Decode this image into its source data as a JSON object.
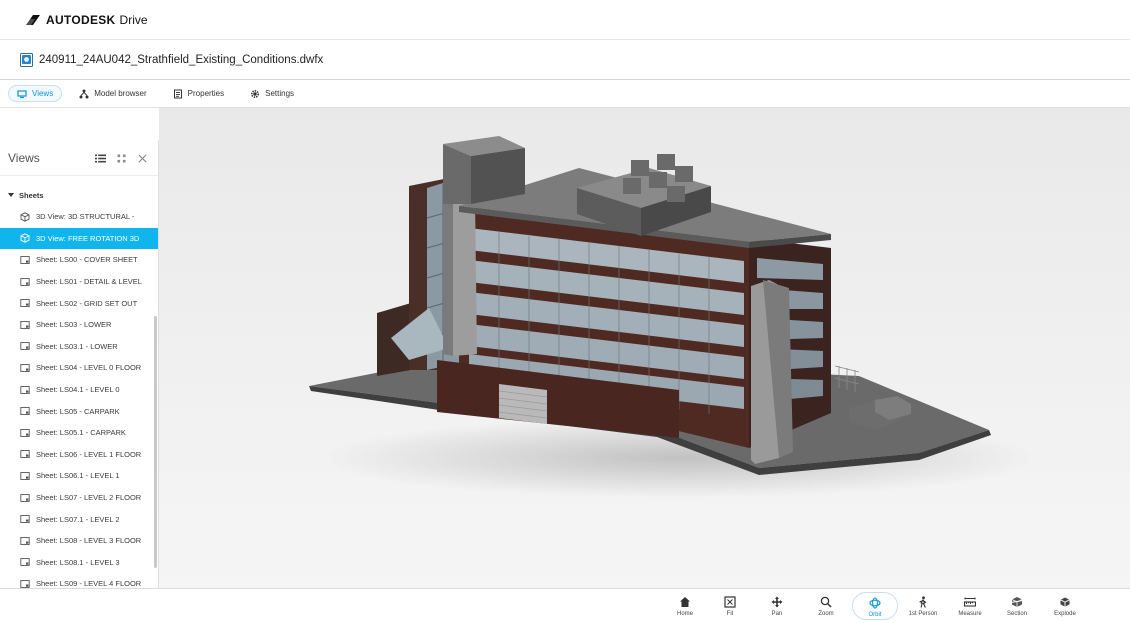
{
  "app": {
    "brand": "AUTODESK",
    "product": "Drive"
  },
  "file": {
    "name": "240911_24AU042_Strathfield_Existing_Conditions.dwfx"
  },
  "tabs": [
    {
      "label": "Views",
      "icon": "views-icon",
      "active": true
    },
    {
      "label": "Model browser",
      "icon": "model-browser-icon",
      "active": false
    },
    {
      "label": "Properties",
      "icon": "properties-icon",
      "active": false
    },
    {
      "label": "Settings",
      "icon": "gear-icon",
      "active": false
    }
  ],
  "panel": {
    "title": "Views",
    "group": "Sheets",
    "items": [
      {
        "label": "3D View: 3D STRUCTURAL -",
        "type": "3d"
      },
      {
        "label": "3D View: FREE ROTATION 3D",
        "type": "3d",
        "selected": true
      },
      {
        "label": "Sheet: LS00 - COVER SHEET",
        "type": "sheet"
      },
      {
        "label": "Sheet: LS01 - DETAIL & LEVEL",
        "type": "sheet"
      },
      {
        "label": "Sheet: LS02 - GRID SET OUT",
        "type": "sheet"
      },
      {
        "label": "Sheet: LS03 - LOWER",
        "type": "sheet"
      },
      {
        "label": "Sheet: LS03.1 - LOWER",
        "type": "sheet"
      },
      {
        "label": "Sheet: LS04 - LEVEL 0 FLOOR",
        "type": "sheet"
      },
      {
        "label": "Sheet: LS04.1 - LEVEL 0",
        "type": "sheet"
      },
      {
        "label": "Sheet: LS05 - CARPARK",
        "type": "sheet"
      },
      {
        "label": "Sheet: LS05.1 - CARPARK",
        "type": "sheet"
      },
      {
        "label": "Sheet: LS06 - LEVEL 1 FLOOR",
        "type": "sheet"
      },
      {
        "label": "Sheet: LS06.1 - LEVEL 1",
        "type": "sheet"
      },
      {
        "label": "Sheet: LS07 - LEVEL 2 FLOOR",
        "type": "sheet"
      },
      {
        "label": "Sheet: LS07.1 - LEVEL 2",
        "type": "sheet"
      },
      {
        "label": "Sheet: LS08 - LEVEL 3 FLOOR",
        "type": "sheet"
      },
      {
        "label": "Sheet: LS08.1 - LEVEL 3",
        "type": "sheet"
      },
      {
        "label": "Sheet: LS09 - LEVEL 4 FLOOR",
        "type": "sheet"
      }
    ]
  },
  "toolbar": {
    "tools": [
      {
        "label": "Home",
        "icon": "home-icon"
      },
      {
        "label": "Fit",
        "icon": "fit-icon"
      },
      {
        "label": "Pan",
        "icon": "pan-icon"
      },
      {
        "label": "Zoom",
        "icon": "zoom-icon"
      },
      {
        "label": "Orbit",
        "icon": "orbit-icon",
        "active": true
      },
      {
        "label": "1st Person",
        "icon": "first-person-icon"
      },
      {
        "label": "Measure",
        "icon": "measure-icon"
      },
      {
        "label": "Section",
        "icon": "section-icon"
      },
      {
        "label": "Explode",
        "icon": "explode-icon"
      }
    ]
  },
  "colors": {
    "accent": "#0696d7",
    "selected_row": "#10b5ed",
    "brick": "#5a2a22"
  }
}
